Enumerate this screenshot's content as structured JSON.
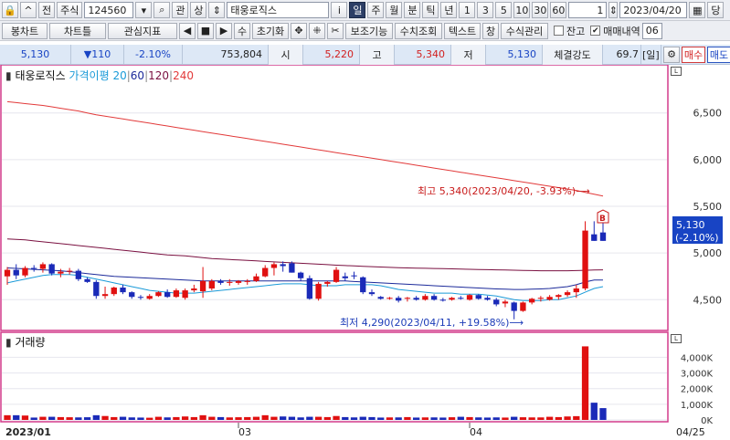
{
  "toolbar1": {
    "left_buttons": [
      "🔒",
      "^",
      "전",
      "주식"
    ],
    "code": "124560",
    "search_btn": "⌕",
    "group_btns": [
      "관",
      "상"
    ],
    "stock_name": "태웅로직스",
    "info_btn": "i",
    "periods": [
      "일",
      "주",
      "월",
      "분",
      "틱",
      "년"
    ],
    "active_period": "일",
    "numbers": [
      "1",
      "3",
      "5",
      "10",
      "30",
      "60"
    ],
    "count_value": "1",
    "date_value": "2023/04/20",
    "date_label": "당"
  },
  "toolbar2": {
    "items": [
      "봉차트",
      "차트틀",
      "관심지표",
      "◀",
      "■",
      "▶",
      "수",
      "초기화",
      "✥",
      "⁜",
      "✂",
      "보조기능",
      "수치조회",
      "텍스트",
      "창",
      "수식관리"
    ],
    "check1_label": "잔고",
    "check2_label": "매매내역",
    "check2_checked": true,
    "tail_value": "06"
  },
  "quote": {
    "price": "5,130",
    "change": "▼110",
    "change_pct": "-2.10%",
    "volume": "753,804",
    "open_label": "시",
    "open": "5,220",
    "high_label": "고",
    "high": "5,340",
    "low_label": "저",
    "low": "5,130",
    "strength_label": "체결강도",
    "strength": "69.7",
    "strength_unit": "[일]",
    "buy_label": "매수",
    "sell_label": "매도"
  },
  "price_panel": {
    "name": "태웅로직스",
    "ma_label": "가격이평",
    "ma_periods": [
      "20",
      "60",
      "120",
      "240"
    ],
    "ma_colors": [
      "#1a9ad8",
      "#1c2a9a",
      "#7a1040",
      "#e23a3a"
    ],
    "high_annotation": "최고 5,340(2023/04/20, -3.93%)⟶",
    "low_annotation": "최저 4,290(2023/04/11, +19.58%)⟶",
    "current_tag": "5,130",
    "current_tag_pct": "(-2.10%)",
    "signal_mark": "B",
    "panel_tag": "L"
  },
  "volume_panel": {
    "name": "거래량",
    "panel_tag": "L"
  },
  "x_axis": {
    "labels": [
      {
        "index": 0,
        "text": "2023/01"
      },
      {
        "index": 26,
        "text": "03"
      },
      {
        "index": 52,
        "text": "04"
      }
    ],
    "right_label": "04/25"
  },
  "colors": {
    "up": "#e01010",
    "down": "#1a2ab8",
    "frame": "#d23a8a",
    "grid": "#e6e6ee"
  },
  "chart_data": {
    "type": "candlestick",
    "y_axis_price": {
      "ticks": [
        4500,
        5000,
        5500,
        6000,
        6500
      ],
      "tick_labels": [
        "4,500",
        "5,000",
        "5,500",
        "6,000",
        "6,500"
      ],
      "ylim": [
        4200,
        6800
      ]
    },
    "y_axis_volume": {
      "ticks": [
        0,
        1000000,
        2000000,
        3000000,
        4000000
      ],
      "tick_labels": [
        "0K",
        "1,000K",
        "2,000K",
        "3,000K",
        "4,000K"
      ],
      "ylim": [
        0,
        4900000
      ]
    },
    "candles": [
      {
        "o": 4750,
        "h": 4850,
        "l": 4660,
        "c": 4820
      },
      {
        "o": 4820,
        "h": 4880,
        "l": 4720,
        "c": 4760
      },
      {
        "o": 4760,
        "h": 4860,
        "l": 4740,
        "c": 4840
      },
      {
        "o": 4840,
        "h": 4870,
        "l": 4800,
        "c": 4830
      },
      {
        "o": 4830,
        "h": 4900,
        "l": 4790,
        "c": 4880
      },
      {
        "o": 4880,
        "h": 4890,
        "l": 4760,
        "c": 4780
      },
      {
        "o": 4780,
        "h": 4830,
        "l": 4740,
        "c": 4800
      },
      {
        "o": 4800,
        "h": 4840,
        "l": 4770,
        "c": 4810
      },
      {
        "o": 4810,
        "h": 4830,
        "l": 4700,
        "c": 4720
      },
      {
        "o": 4720,
        "h": 4740,
        "l": 4680,
        "c": 4690
      },
      {
        "o": 4690,
        "h": 4710,
        "l": 4510,
        "c": 4540
      },
      {
        "o": 4540,
        "h": 4640,
        "l": 4510,
        "c": 4560
      },
      {
        "o": 4560,
        "h": 4640,
        "l": 4540,
        "c": 4630
      },
      {
        "o": 4630,
        "h": 4660,
        "l": 4560,
        "c": 4580
      },
      {
        "o": 4580,
        "h": 4590,
        "l": 4510,
        "c": 4530
      },
      {
        "o": 4530,
        "h": 4550,
        "l": 4500,
        "c": 4520
      },
      {
        "o": 4510,
        "h": 4560,
        "l": 4500,
        "c": 4540
      },
      {
        "o": 4540,
        "h": 4590,
        "l": 4530,
        "c": 4580
      },
      {
        "o": 4580,
        "h": 4610,
        "l": 4520,
        "c": 4530
      },
      {
        "o": 4530,
        "h": 4620,
        "l": 4520,
        "c": 4600
      },
      {
        "o": 4520,
        "h": 4620,
        "l": 4500,
        "c": 4600
      },
      {
        "o": 4600,
        "h": 4660,
        "l": 4580,
        "c": 4620
      },
      {
        "o": 4590,
        "h": 4850,
        "l": 4520,
        "c": 4700
      },
      {
        "o": 4620,
        "h": 4720,
        "l": 4600,
        "c": 4700
      },
      {
        "o": 4700,
        "h": 4720,
        "l": 4660,
        "c": 4680
      },
      {
        "o": 4680,
        "h": 4720,
        "l": 4650,
        "c": 4690
      },
      {
        "o": 4680,
        "h": 4710,
        "l": 4660,
        "c": 4700
      },
      {
        "o": 4690,
        "h": 4720,
        "l": 4660,
        "c": 4700
      },
      {
        "o": 4700,
        "h": 4780,
        "l": 4690,
        "c": 4750
      },
      {
        "o": 4750,
        "h": 4870,
        "l": 4740,
        "c": 4840
      },
      {
        "o": 4840,
        "h": 4900,
        "l": 4760,
        "c": 4880
      },
      {
        "o": 4880,
        "h": 4910,
        "l": 4800,
        "c": 4860
      },
      {
        "o": 4890,
        "h": 4910,
        "l": 4790,
        "c": 4790
      },
      {
        "o": 4790,
        "h": 4800,
        "l": 4700,
        "c": 4730
      },
      {
        "o": 4730,
        "h": 4760,
        "l": 4500,
        "c": 4510
      },
      {
        "o": 4510,
        "h": 4690,
        "l": 4490,
        "c": 4670
      },
      {
        "o": 4670,
        "h": 4700,
        "l": 4640,
        "c": 4690
      },
      {
        "o": 4690,
        "h": 4850,
        "l": 4680,
        "c": 4820
      },
      {
        "o": 4750,
        "h": 4790,
        "l": 4700,
        "c": 4730
      },
      {
        "o": 4760,
        "h": 4800,
        "l": 4720,
        "c": 4750
      },
      {
        "o": 4740,
        "h": 4750,
        "l": 4560,
        "c": 4580
      },
      {
        "o": 4580,
        "h": 4610,
        "l": 4540,
        "c": 4560
      },
      {
        "o": 4530,
        "h": 4540,
        "l": 4500,
        "c": 4510
      },
      {
        "o": 4510,
        "h": 4530,
        "l": 4500,
        "c": 4520
      },
      {
        "o": 4520,
        "h": 4540,
        "l": 4470,
        "c": 4490
      },
      {
        "o": 4510,
        "h": 4530,
        "l": 4480,
        "c": 4520
      },
      {
        "o": 4520,
        "h": 4540,
        "l": 4490,
        "c": 4500
      },
      {
        "o": 4500,
        "h": 4560,
        "l": 4490,
        "c": 4540
      },
      {
        "o": 4540,
        "h": 4560,
        "l": 4490,
        "c": 4500
      },
      {
        "o": 4500,
        "h": 4520,
        "l": 4480,
        "c": 4490
      },
      {
        "o": 4500,
        "h": 4530,
        "l": 4490,
        "c": 4520
      },
      {
        "o": 4520,
        "h": 4540,
        "l": 4500,
        "c": 4510
      },
      {
        "o": 4500,
        "h": 4560,
        "l": 4490,
        "c": 4550
      },
      {
        "o": 4550,
        "h": 4560,
        "l": 4500,
        "c": 4510
      },
      {
        "o": 4520,
        "h": 4540,
        "l": 4490,
        "c": 4500
      },
      {
        "o": 4500,
        "h": 4520,
        "l": 4430,
        "c": 4450
      },
      {
        "o": 4460,
        "h": 4500,
        "l": 4420,
        "c": 4480
      },
      {
        "o": 4470,
        "h": 4480,
        "l": 4290,
        "c": 4380
      },
      {
        "o": 4380,
        "h": 4480,
        "l": 4370,
        "c": 4470
      },
      {
        "o": 4470,
        "h": 4520,
        "l": 4450,
        "c": 4510
      },
      {
        "o": 4510,
        "h": 4540,
        "l": 4480,
        "c": 4520
      },
      {
        "o": 4500,
        "h": 4550,
        "l": 4490,
        "c": 4530
      },
      {
        "o": 4530,
        "h": 4560,
        "l": 4500,
        "c": 4550
      },
      {
        "o": 4550,
        "h": 4600,
        "l": 4530,
        "c": 4580
      },
      {
        "o": 4580,
        "h": 4660,
        "l": 4520,
        "c": 4620
      },
      {
        "o": 4620,
        "h": 5340,
        "l": 4600,
        "c": 5240
      },
      {
        "o": 5200,
        "h": 5340,
        "l": 5130,
        "c": 5130
      },
      {
        "o": 5220,
        "h": 5340,
        "l": 5130,
        "c": 5130
      }
    ],
    "volume": [
      300000,
      300000,
      280000,
      150000,
      200000,
      200000,
      180000,
      170000,
      160000,
      170000,
      300000,
      250000,
      180000,
      200000,
      160000,
      150000,
      140000,
      200000,
      160000,
      180000,
      220000,
      180000,
      300000,
      200000,
      180000,
      160000,
      170000,
      180000,
      200000,
      300000,
      200000,
      220000,
      200000,
      160000,
      200000,
      200000,
      180000,
      250000,
      180000,
      160000,
      200000,
      180000,
      150000,
      160000,
      160000,
      180000,
      150000,
      160000,
      160000,
      150000,
      170000,
      200000,
      180000,
      160000,
      150000,
      160000,
      150000,
      200000,
      170000,
      160000,
      160000,
      200000,
      180000,
      220000,
      240000,
      4700000,
      1100000,
      753804
    ],
    "ma20": [
      4680,
      4700,
      4720,
      4740,
      4760,
      4770,
      4770,
      4770,
      4760,
      4740,
      4720,
      4700,
      4680,
      4660,
      4640,
      4620,
      4600,
      4590,
      4580,
      4570,
      4570,
      4570,
      4580,
      4590,
      4600,
      4610,
      4620,
      4630,
      4640,
      4650,
      4660,
      4670,
      4670,
      4670,
      4660,
      4650,
      4650,
      4650,
      4660,
      4660,
      4660,
      4660,
      4650,
      4630,
      4610,
      4600,
      4590,
      4580,
      4570,
      4570,
      4570,
      4560,
      4560,
      4560,
      4550,
      4540,
      4520,
      4500,
      4490,
      4490,
      4490,
      4500,
      4500,
      4520,
      4540,
      4580,
      4620,
      4640
    ],
    "ma60": [
      4840,
      4835,
      4830,
      4825,
      4820,
      4815,
      4810,
      4800,
      4790,
      4780,
      4770,
      4760,
      4750,
      4745,
      4740,
      4735,
      4730,
      4725,
      4720,
      4715,
      4710,
      4705,
      4700,
      4700,
      4700,
      4700,
      4700,
      4700,
      4700,
      4700,
      4700,
      4700,
      4700,
      4700,
      4700,
      4700,
      4700,
      4700,
      4700,
      4695,
      4690,
      4685,
      4680,
      4675,
      4670,
      4665,
      4660,
      4655,
      4650,
      4645,
      4640,
      4635,
      4630,
      4625,
      4620,
      4615,
      4612,
      4610,
      4610,
      4612,
      4615,
      4620,
      4630,
      4640,
      4660,
      4690,
      4710,
      4710
    ],
    "ma120": [
      5150,
      5145,
      5140,
      5130,
      5120,
      5110,
      5100,
      5090,
      5080,
      5070,
      5060,
      5050,
      5040,
      5030,
      5020,
      5010,
      5000,
      4990,
      4980,
      4975,
      4970,
      4960,
      4950,
      4940,
      4935,
      4930,
      4925,
      4920,
      4915,
      4910,
      4905,
      4900,
      4895,
      4890,
      4885,
      4880,
      4875,
      4870,
      4866,
      4862,
      4858,
      4854,
      4850,
      4846,
      4842,
      4840,
      4838,
      4836,
      4834,
      4832,
      4830,
      4828,
      4826,
      4824,
      4822,
      4820,
      4818,
      4816,
      4814,
      4812,
      4810,
      4810,
      4810,
      4810,
      4812,
      4815,
      4818,
      4820
    ],
    "ma240": [
      6620,
      6610,
      6600,
      6590,
      6580,
      6565,
      6550,
      6535,
      6520,
      6500,
      6480,
      6465,
      6450,
      6435,
      6420,
      6405,
      6390,
      6375,
      6360,
      6345,
      6330,
      6315,
      6300,
      6285,
      6270,
      6255,
      6240,
      6225,
      6210,
      6195,
      6180,
      6165,
      6150,
      6135,
      6120,
      6105,
      6090,
      6075,
      6060,
      6045,
      6030,
      6015,
      6000,
      5985,
      5970,
      5955,
      5940,
      5925,
      5910,
      5895,
      5880,
      5865,
      5850,
      5835,
      5820,
      5805,
      5790,
      5775,
      5760,
      5745,
      5730,
      5715,
      5700,
      5685,
      5670,
      5650,
      5630,
      5610
    ]
  }
}
